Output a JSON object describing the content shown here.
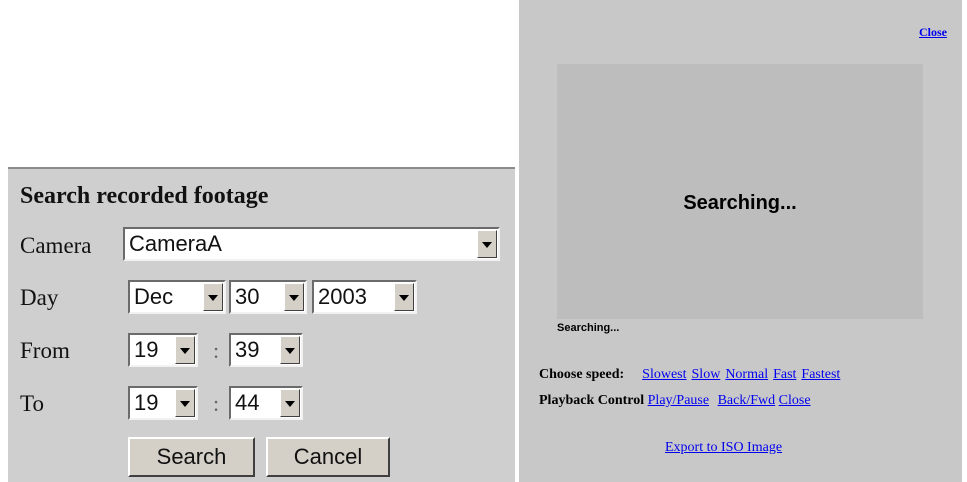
{
  "search": {
    "title": "Search recorded footage",
    "camera_label": "Camera",
    "camera_value": "CameraA",
    "day_label": "Day",
    "day_month": "Dec",
    "day_day": "30",
    "day_year": "2003",
    "from_label": "From",
    "from_hour": "19",
    "from_minute": "39",
    "to_label": "To",
    "to_hour": "19",
    "to_minute": "44",
    "time_separator": ":",
    "search_button": "Search",
    "cancel_button": "Cancel"
  },
  "playback": {
    "close_top": "Close",
    "video_status": "Searching...",
    "search_status": "Searching...",
    "speed_label": "Choose speed:",
    "speeds": [
      "Slowest",
      "Slow",
      "Normal",
      "Fast",
      "Fastest"
    ],
    "control_label": "Playback Control",
    "play_pause": "Play/Pause",
    "back_fwd": "Back/Fwd",
    "close": "Close",
    "export": "Export to ISO Image"
  }
}
